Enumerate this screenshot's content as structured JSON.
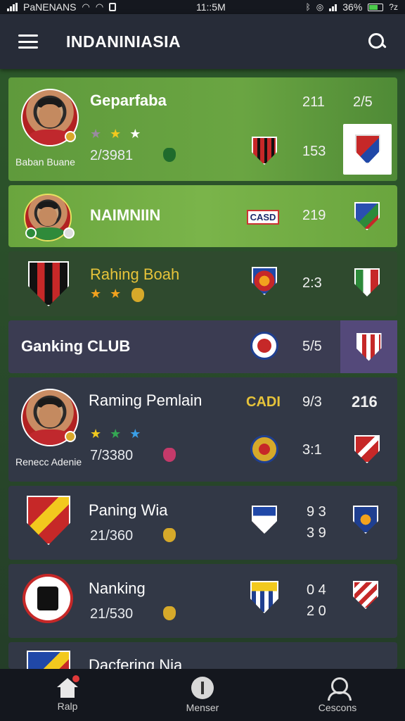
{
  "status": {
    "carrier": "PaNENANS",
    "time": "11::5M",
    "battery": "36%",
    "extra": "?z"
  },
  "header": {
    "title": "INDANINIASIA"
  },
  "rows": [
    {
      "name": "Geparfaba",
      "caption": "Baban Buane",
      "score": "2/3981",
      "col1": "211",
      "col2": "2/5",
      "col3": "153"
    },
    {
      "name": "NAIMNIIN",
      "crest_text": "CASD",
      "col1": "219"
    },
    {
      "name": "Rahing Boah",
      "col1": "2:3"
    },
    {
      "name": "Ganking CLUB",
      "col1": "5/5"
    },
    {
      "name": "Raming Pemlain",
      "caption": "Renecc Adenie",
      "score": "7/3380",
      "tag": "CADI",
      "col1": "9/3",
      "col2": "216",
      "col3": "3:1"
    },
    {
      "name": "Paning Wia",
      "score": "21/360",
      "col1": "9 3",
      "col2": "3 9"
    },
    {
      "name": "Nanking",
      "score": "21/530",
      "col1": "0 4",
      "col2": "2 0"
    },
    {
      "name": "Dacfering Nia"
    }
  ],
  "nav": {
    "items": [
      {
        "label": "Ralp"
      },
      {
        "label": "Menser"
      },
      {
        "label": "Cescons"
      }
    ]
  },
  "colors": {
    "accent_green": "#6da33e",
    "row_dark": "#323846",
    "row_purple": "#4a4560",
    "gold": "#e6c33a"
  }
}
